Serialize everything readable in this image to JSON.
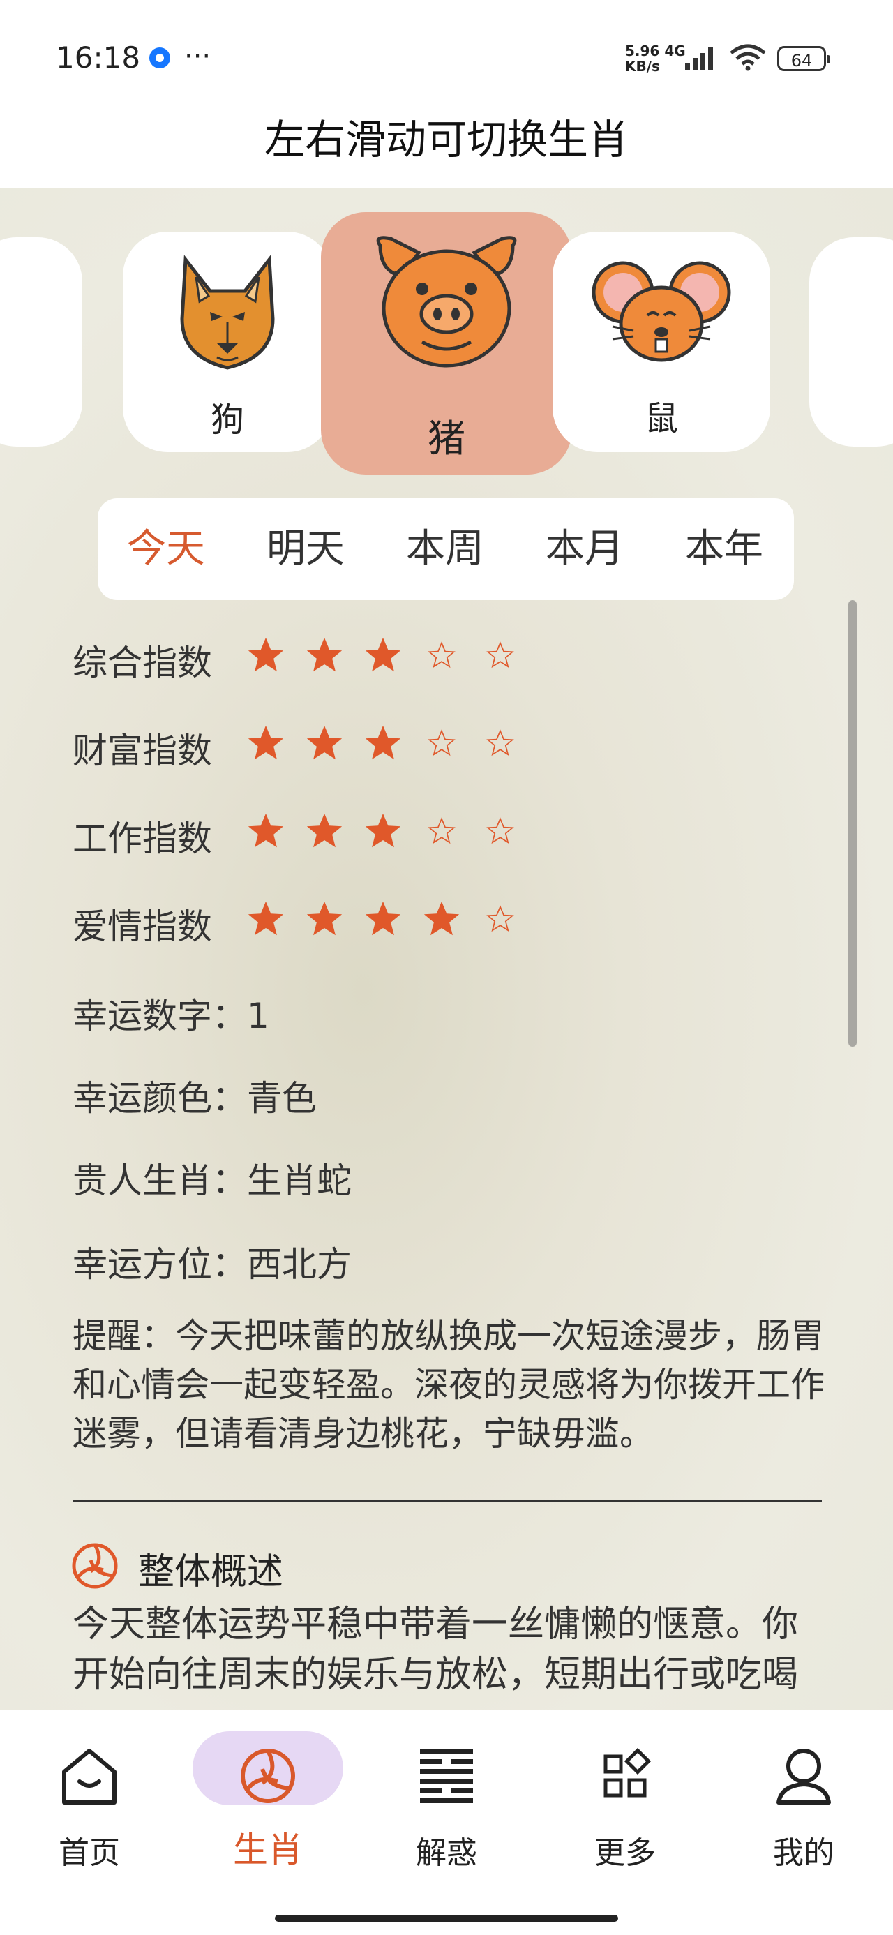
{
  "status_bar": {
    "time": "16:18",
    "more": "···",
    "net_speed": "5.96",
    "net_unit": "KB/s",
    "net_type": "4G",
    "battery": "64"
  },
  "header": {
    "title": "左右滑动可切换生肖"
  },
  "zodiac_carousel": {
    "items": [
      {
        "name": "狗",
        "icon": "dog-icon"
      },
      {
        "name": "猪",
        "icon": "pig-icon",
        "selected": true
      },
      {
        "name": "鼠",
        "icon": "rat-icon"
      }
    ]
  },
  "period_tabs": {
    "items": [
      "今天",
      "明天",
      "本周",
      "本月",
      "本年"
    ],
    "active_index": 0
  },
  "indices": [
    {
      "label": "综合指数",
      "stars": 3,
      "max": 5
    },
    {
      "label": "财富指数",
      "stars": 3,
      "max": 5
    },
    {
      "label": "工作指数",
      "stars": 3,
      "max": 5
    },
    {
      "label": "爱情指数",
      "stars": 4,
      "max": 5
    }
  ],
  "lucky": {
    "number": "幸运数字：1",
    "color": "幸运颜色：青色",
    "noble_zodiac": "贵人生肖：生肖蛇",
    "direction": "幸运方位：西北方"
  },
  "reminder": "提醒：今天把味蕾的放纵换成一次短途漫步，肠胃和心情会一起变轻盈。深夜的灵感将为你拨开工作迷雾，但请看清身边桃花，宁缺毋滥。",
  "overview": {
    "title": "整体概述",
    "text": "今天整体运势平稳中带着一丝慵懒的惬意。你开始向往周末的娱乐与放松，短期出行或吃喝"
  },
  "bottom_nav": {
    "items": [
      {
        "label": "首页",
        "icon": "home-icon"
      },
      {
        "label": "生肖",
        "icon": "zodiac-icon"
      },
      {
        "label": "解惑",
        "icon": "hexagram-icon"
      },
      {
        "label": "更多",
        "icon": "grid-icon"
      },
      {
        "label": "我的",
        "icon": "user-icon"
      }
    ],
    "active_index": 1
  },
  "colors": {
    "accent": "#d65a2f",
    "star": "#e0582a",
    "selected_card": "#e8ac95",
    "nav_pill": "#e6d8f4"
  }
}
